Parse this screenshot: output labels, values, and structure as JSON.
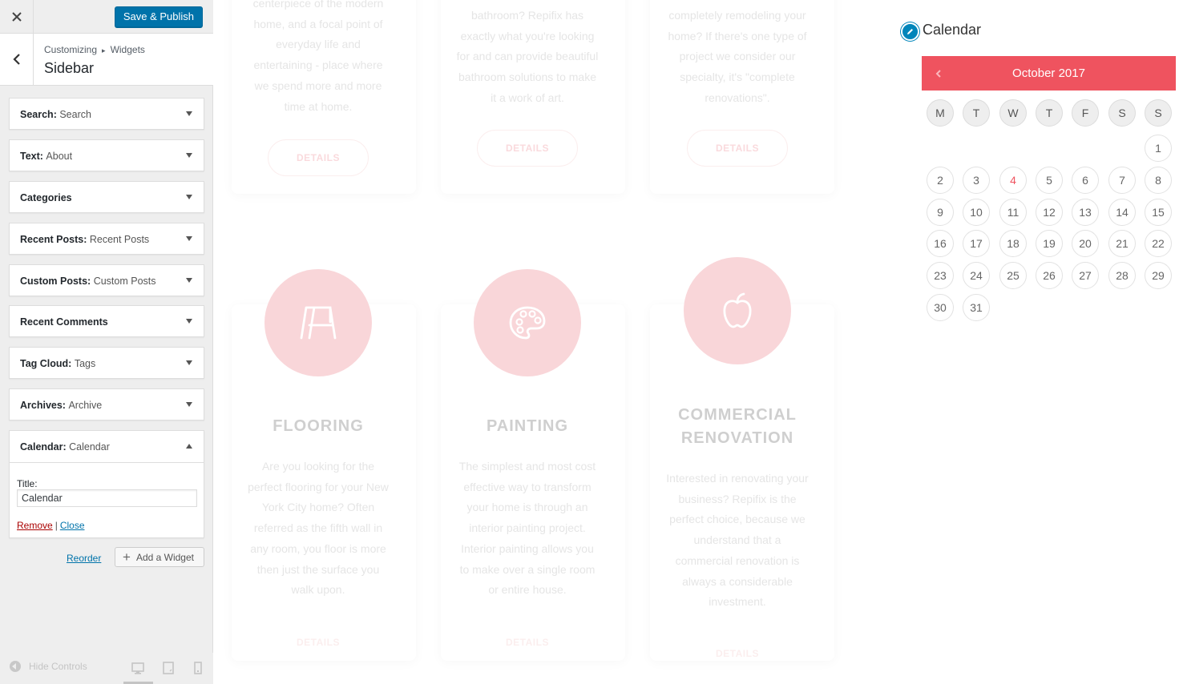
{
  "customizer": {
    "publish_label": "Save & Publish",
    "close_icon": "close-icon",
    "breadcrumb": {
      "root": "Customizing",
      "child": "Widgets"
    },
    "section_title": "Sidebar",
    "widgets": [
      {
        "type": "Search:",
        "instance": "Search"
      },
      {
        "type": "Text:",
        "instance": "About"
      },
      {
        "type": "Categories",
        "instance": ""
      },
      {
        "type": "Recent Posts:",
        "instance": "Recent Posts"
      },
      {
        "type": "Custom Posts:",
        "instance": "Custom Posts"
      },
      {
        "type": "Recent Comments",
        "instance": ""
      },
      {
        "type": "Tag Cloud:",
        "instance": "Tags"
      },
      {
        "type": "Archives:",
        "instance": "Archive"
      },
      {
        "type": "Calendar:",
        "instance": "Calendar",
        "expanded": true
      }
    ],
    "calendar_form": {
      "title_label": "Title:",
      "title_value": "Calendar",
      "remove_label": "Remove",
      "separator": "|",
      "close_label": "Close"
    },
    "reorder_label": "Reorder",
    "add_widget_label": "Add a Widget",
    "hide_controls_label": "Hide Controls",
    "accent_color": "#0073aa"
  },
  "preview": {
    "top_cards": [
      {
        "text": [
          "centerpiece of the modern",
          "home, and a focal point of",
          "everyday life and",
          "entertaining - place where",
          "we spend more and more",
          "time at home."
        ],
        "button": "DETAILS"
      },
      {
        "text": [
          "bathroom? Repifix has",
          "exactly what you're looking",
          "for and can provide beautiful",
          "bathroom solutions to make",
          "it a work of art."
        ],
        "button": "DETAILS"
      },
      {
        "text": [
          "completely remodeling your",
          "home? If there's one type of",
          "project we consider our",
          "specialty, it's \"complete",
          "renovations\"."
        ],
        "button": "DETAILS"
      }
    ],
    "services": [
      {
        "icon": "easel-icon",
        "title": [
          "FLOORING"
        ],
        "text": [
          "Are you looking for the",
          "perfect flooring for your New",
          "York City home? Often",
          "referred as the fifth wall in",
          "any room, you floor is more",
          "then just the surface you",
          "walk upon."
        ],
        "button": "DETAILS"
      },
      {
        "icon": "palette-icon",
        "title": [
          "PAINTING"
        ],
        "text": [
          "The simplest and most cost",
          "effective way to transform",
          "your home is through an",
          "interior painting project.",
          "Interior painting allows you",
          "to make over a single room",
          "or entire house."
        ],
        "button": "DETAILS"
      },
      {
        "icon": "apple-icon",
        "title": [
          "COMMERCIAL",
          "RENOVATION"
        ],
        "text": [
          "Interested in renovating your",
          "business? Repifix is the",
          "perfect choice, because we",
          "understand that a",
          "commercial renovation is",
          "always a considerable",
          "investment."
        ],
        "button": "DETAILS"
      }
    ],
    "accent_color": "#f9d6d9"
  },
  "calendar_widget": {
    "title": "Calendar",
    "month_label": "October 2017",
    "prev_icon": "chevron-left-icon",
    "weekdays": [
      "M",
      "T",
      "W",
      "T",
      "F",
      "S",
      "S"
    ],
    "first_weekday_index": 6,
    "days_in_month": 31,
    "today": 4,
    "header_color": "#ef535f"
  }
}
